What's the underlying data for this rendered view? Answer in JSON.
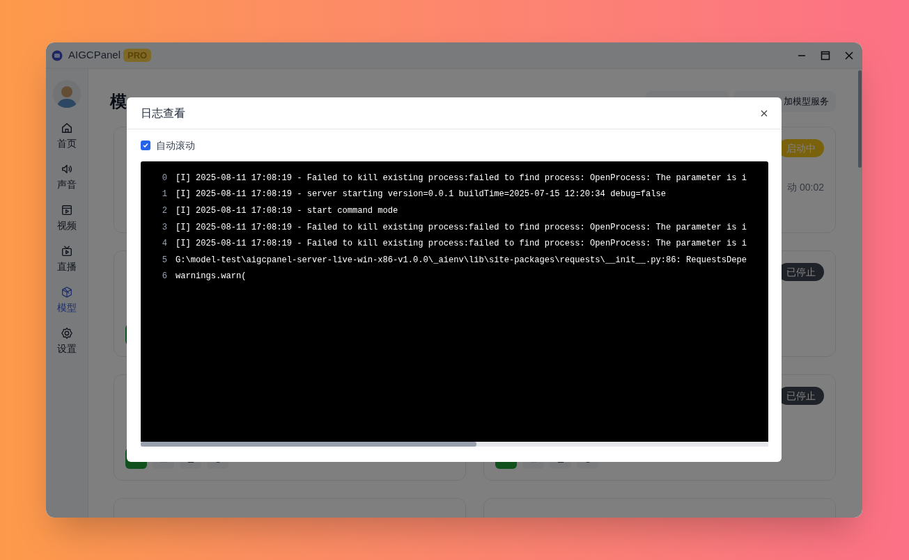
{
  "window": {
    "title": "AIGCPanel",
    "badge": "PRO"
  },
  "sidebar": {
    "items": [
      {
        "label": "首页",
        "selected": false
      },
      {
        "label": "声音",
        "selected": false
      },
      {
        "label": "视频",
        "selected": false
      },
      {
        "label": "直播",
        "selected": false
      },
      {
        "label": "模型",
        "selected": true
      },
      {
        "label": "设置",
        "selected": false
      }
    ]
  },
  "page": {
    "title": "模",
    "add_button": "加模型服务"
  },
  "cards": [
    {
      "kind": "model"
    },
    {
      "kind": "model",
      "status": {
        "label": "启动中",
        "kind": "starting"
      },
      "runtime": "动 00:02"
    },
    {
      "kind": "model",
      "actions": [
        {
          "kind": "start"
        }
      ]
    },
    {
      "kind": "model",
      "status": {
        "label": "已停止",
        "kind": "stopped"
      }
    },
    {
      "kind": "model",
      "actions": [
        {
          "kind": "start"
        },
        {
          "kind": "log"
        },
        {
          "kind": "delete"
        },
        {
          "kind": "info"
        }
      ]
    },
    {
      "kind": "model",
      "status": {
        "label": "已停止",
        "kind": "stopped"
      },
      "actions": [
        {
          "kind": "start"
        },
        {
          "kind": "log"
        },
        {
          "kind": "delete"
        },
        {
          "kind": "info"
        }
      ]
    },
    {
      "kind": "model"
    },
    {
      "kind": "model"
    }
  ],
  "dialog": {
    "title": "日志查看",
    "auto_scroll": {
      "label": "自动滚动",
      "checked": true
    },
    "lines": [
      {
        "number": "0",
        "text": "[I] 2025-08-11 17:08:19 - Failed to kill existing process:failed to find process: OpenProcess: The parameter is i"
      },
      {
        "number": "1",
        "text": "[I] 2025-08-11 17:08:19 - server starting version=0.0.1 buildTime=2025-07-15 12:20:34 debug=false"
      },
      {
        "number": "2",
        "text": "[I] 2025-08-11 17:08:19 - start command mode"
      },
      {
        "number": "3",
        "text": "[I] 2025-08-11 17:08:19 - Failed to kill existing process:failed to find process: OpenProcess: The parameter is i"
      },
      {
        "number": "4",
        "text": "[I] 2025-08-11 17:08:19 - Failed to kill existing process:failed to find process: OpenProcess: The parameter is i"
      },
      {
        "number": "5",
        "text": "G:\\model-test\\aigcpanel-server-live-win-x86-v1.0.0\\_aienv\\lib\\site-packages\\requests\\__init__.py:86: RequestsDepe"
      },
      {
        "number": "6",
        "text": "warnings.warn("
      }
    ]
  }
}
